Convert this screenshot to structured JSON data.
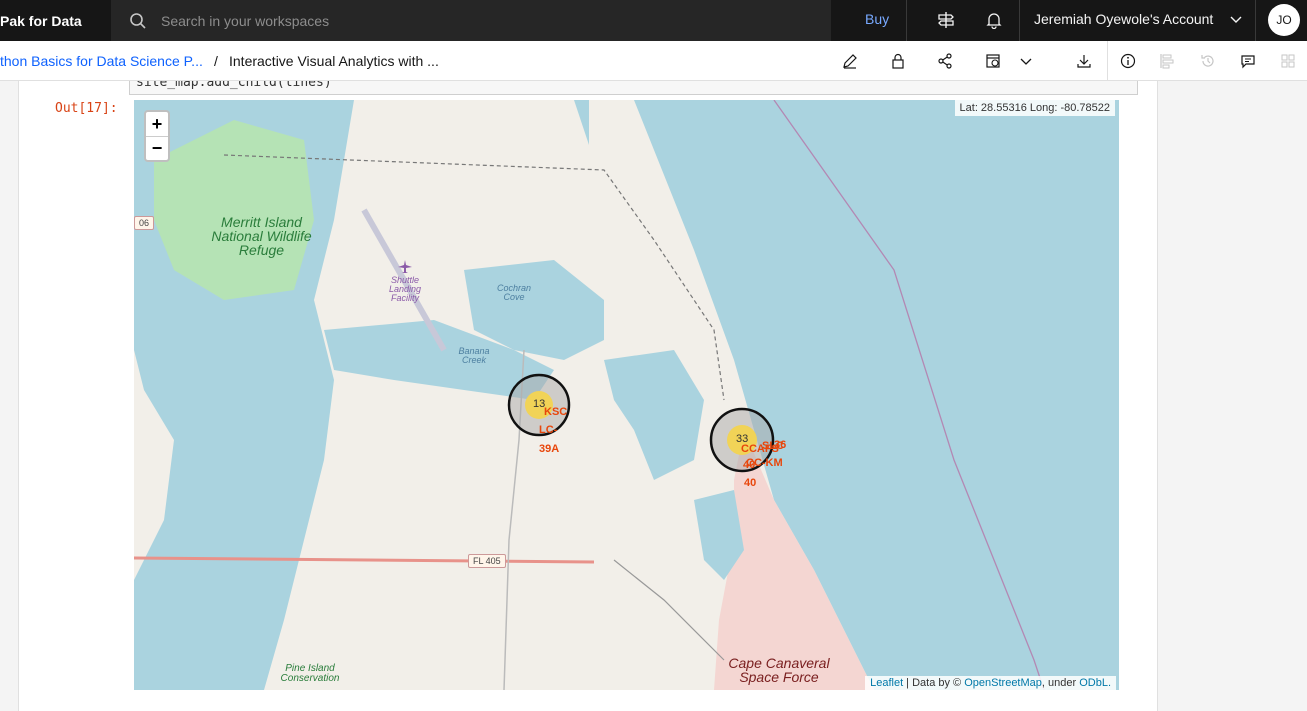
{
  "topbar": {
    "brand": "Pak for Data",
    "search_placeholder": "Search in your workspaces",
    "buy_label": "Buy",
    "account_label": "Jeremiah Oyewole's Account",
    "avatar_initials": "JO"
  },
  "breadcrumb": {
    "project": "thon Basics for Data Science P...",
    "separator": "/",
    "notebook": "Interactive Visual Analytics with ..."
  },
  "cell": {
    "code_fragment": "site_map.add_child(lines)",
    "output_prompt": "Out[17]:"
  },
  "map": {
    "zoom_in": "+",
    "zoom_out": "−",
    "mouse_position": "Lat: 28.55316 Long: -80.78522",
    "attribution": {
      "leaflet": "Leaflet",
      "data_by": " | Data by © ",
      "osm": "OpenStreetMap",
      "under": ", under ",
      "license": "ODbL."
    },
    "places": {
      "refuge": "Merritt Island National Wildlife Refuge",
      "slf": "Shuttle Landing Facility",
      "cochran": "Cochran Cove",
      "banana": "Banana Creek",
      "space_force": "Cape Canaveral Space Force",
      "pine_island": "Pine Island Conservation",
      "road": "FL 405",
      "road_edge": "06"
    },
    "clusters": [
      {
        "count": "13",
        "labels": [
          "KSC",
          "LC-",
          "39A"
        ]
      },
      {
        "count": "33",
        "labels": [
          "CCAFS",
          "SLC",
          "36",
          "CC-KM",
          "40",
          "40"
        ]
      }
    ]
  },
  "colors": {
    "water": "#aad3df",
    "land": "#f2efe9",
    "wetland": "#b5e3b5",
    "marker_label": "#e8460b",
    "cluster": "#f1d357"
  }
}
